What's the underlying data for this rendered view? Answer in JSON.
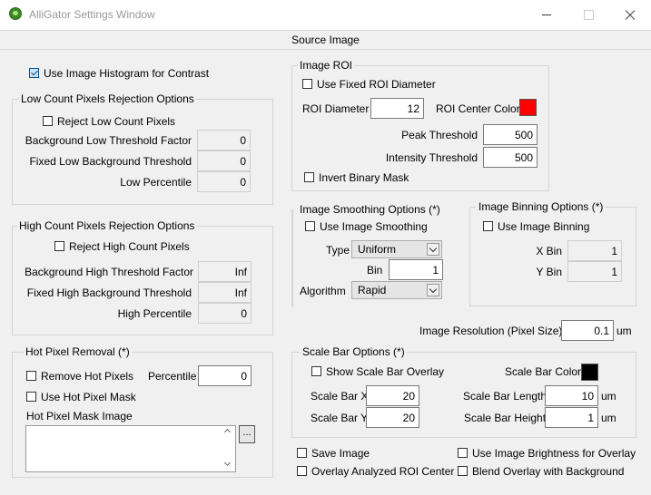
{
  "window": {
    "title": "AlliGator Settings Window",
    "tab": "Source Image"
  },
  "use_histogram": {
    "label": "Use Image Histogram for Contrast",
    "checked": true
  },
  "low_count": {
    "title": "Low Count Pixels Rejection Options",
    "reject_label": "Reject Low Count Pixels",
    "bg_factor_label": "Background Low Threshold Factor",
    "bg_factor": "0",
    "fixed_label": "Fixed Low Background Threshold",
    "fixed": "0",
    "percentile_label": "Low Percentile",
    "percentile": "0"
  },
  "high_count": {
    "title": "High Count Pixels Rejection Options",
    "reject_label": "Reject High Count Pixels",
    "bg_factor_label": "Background High Threshold Factor",
    "bg_factor": "Inf",
    "fixed_label": "Fixed High Background Threshold",
    "fixed": "Inf",
    "percentile_label": "High Percentile",
    "percentile": "0"
  },
  "hot_pixel": {
    "title": "Hot Pixel Removal (*)",
    "remove_label": "Remove Hot Pixels",
    "percentile_label": "Percentile",
    "percentile": "0",
    "mask_label": "Use Hot Pixel Mask",
    "mask_image_label": "Hot Pixel Mask Image",
    "browse_label": "..."
  },
  "roi": {
    "title": "Image ROI",
    "fixed_label": "Use Fixed ROI Diameter",
    "diameter_label": "ROI Diameter",
    "diameter": "12",
    "center_color_label": "ROI Center Color",
    "center_color": "#ff0000",
    "peak_label": "Peak Threshold",
    "peak": "500",
    "intensity_label": "Intensity Threshold",
    "intensity": "500",
    "invert_label": "Invert Binary Mask"
  },
  "smoothing": {
    "title": "Image Smoothing Options (*)",
    "use_label": "Use Image Smoothing",
    "type_label": "Type",
    "type": "Uniform",
    "bin_label": "Bin",
    "bin": "1",
    "algorithm_label": "Algorithm",
    "algorithm": "Rapid"
  },
  "binning": {
    "title": "Image Binning Options (*)",
    "use_label": "Use Image Binning",
    "xbin_label": "X Bin",
    "xbin": "1",
    "ybin_label": "Y Bin",
    "ybin": "1"
  },
  "resolution": {
    "label": "Image Resolution (Pixel Size)",
    "value": "0.1",
    "unit": "um"
  },
  "scale_bar": {
    "title": "Scale Bar Options (*)",
    "show_label": "Show Scale Bar Overlay",
    "color_label": "Scale Bar Color",
    "color": "#000000",
    "x_label": "Scale Bar X",
    "x": "20",
    "y_label": "Scale Bar Y",
    "y": "20",
    "length_label": "Scale Bar Length",
    "length": "10",
    "length_unit": "um",
    "height_label": "Scale Bar Height",
    "height": "1",
    "height_unit": "um"
  },
  "bottom": {
    "save_image": "Save Image",
    "overlay_center": "Overlay Analyzed ROI Center",
    "brightness_overlay": "Use Image Brightness for Overlay",
    "blend_overlay": "Blend Overlay with Background"
  }
}
